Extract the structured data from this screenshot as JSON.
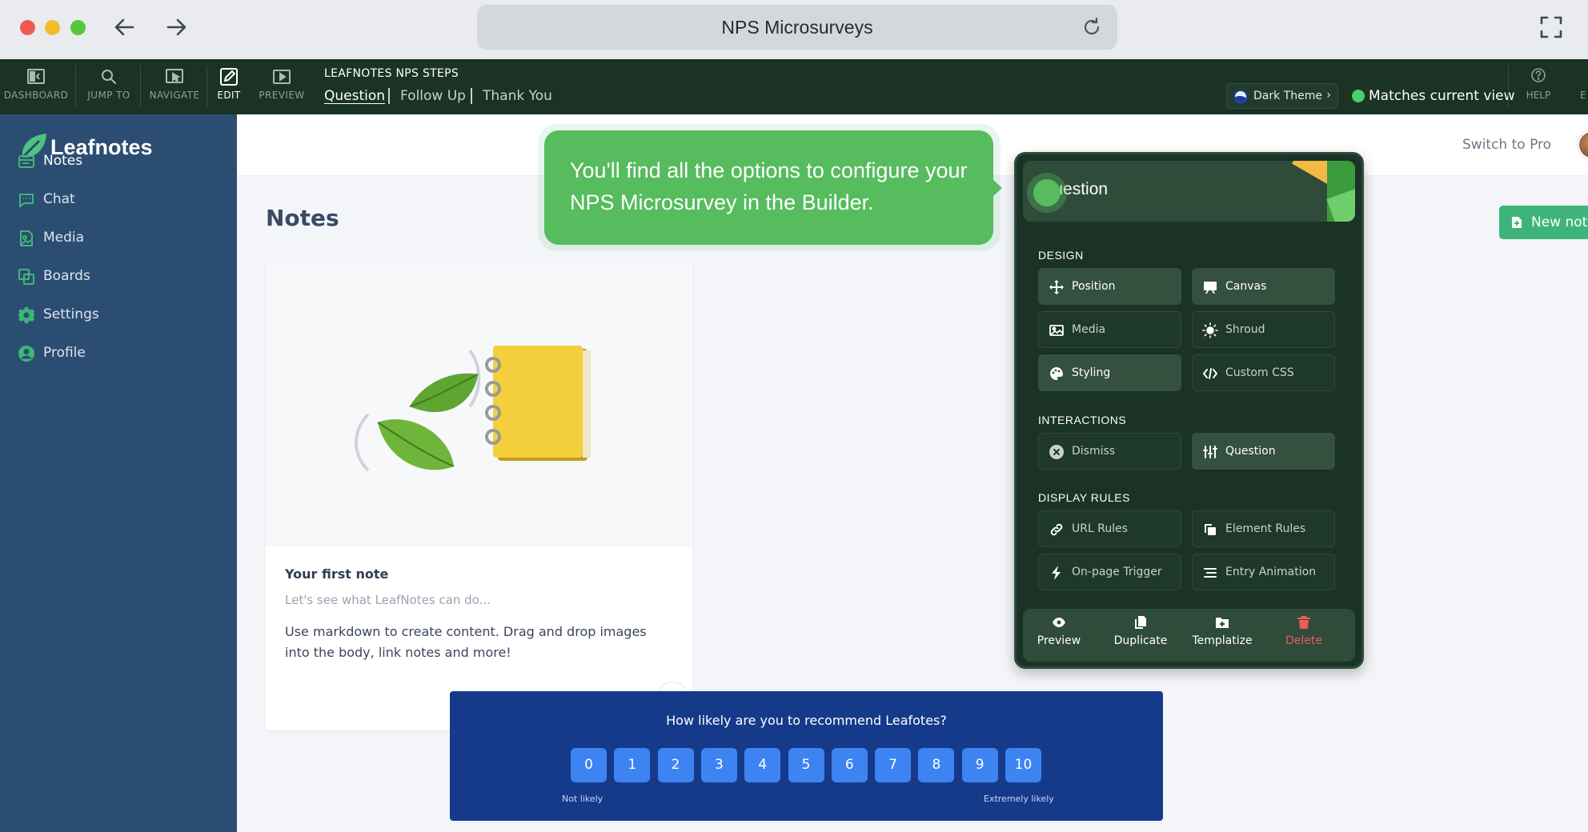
{
  "window": {
    "title": "NPS Microsurveys"
  },
  "toolbar": {
    "tools": [
      {
        "label": "DASHBOARD",
        "icon": "dashboard-icon"
      },
      {
        "label": "JUMP TO",
        "icon": "search-icon"
      },
      {
        "label": "NAVIGATE",
        "icon": "cursor-icon"
      },
      {
        "label": "EDIT",
        "icon": "edit-icon",
        "active": true
      },
      {
        "label": "PREVIEW",
        "icon": "play-icon"
      }
    ],
    "steps_heading": "LEAFNOTES NPS STEPS",
    "steps": [
      {
        "label": "Question",
        "active": true
      },
      {
        "label": "Follow Up"
      },
      {
        "label": "Thank You"
      }
    ],
    "theme_label": "Dark Theme",
    "match_label": "Matches current view",
    "help_label": "HELP",
    "help_cut": "E"
  },
  "app": {
    "brand": "Leafnotes",
    "nav": [
      {
        "label": "Notes",
        "icon": "notes-icon",
        "active": true
      },
      {
        "label": "Chat",
        "icon": "chat-icon"
      },
      {
        "label": "Media",
        "icon": "media-icon"
      },
      {
        "label": "Boards",
        "icon": "boards-icon"
      },
      {
        "label": "Settings",
        "icon": "gear-icon"
      },
      {
        "label": "Profile",
        "icon": "profile-icon"
      }
    ],
    "switch_pro": "Switch to Pro",
    "page_title": "Notes",
    "new_note": "New note"
  },
  "card": {
    "title": "Your first note",
    "subtitle": "Let's see what LeafNotes can do...",
    "body": "Use markdown to create content. Drag and drop images into the body, link notes and more!"
  },
  "tooltip": {
    "text": "You'll find all the options to configure your NPS Microsurvey in the Builder."
  },
  "builder": {
    "title": "Question",
    "sections": {
      "design": "DESIGN",
      "interactions": "INTERACTIONS",
      "display_rules": "DISPLAY RULES"
    },
    "design_buttons": [
      {
        "label": "Position",
        "icon": "move-icon"
      },
      {
        "label": "Canvas",
        "icon": "canvas-icon"
      },
      {
        "label": "Media",
        "icon": "image-icon"
      },
      {
        "label": "Shroud",
        "icon": "sun-icon"
      },
      {
        "label": "Styling",
        "icon": "palette-icon"
      },
      {
        "label": "Custom CSS",
        "icon": "code-icon"
      }
    ],
    "interaction_buttons": [
      {
        "label": "Dismiss",
        "icon": "close-circle-icon"
      },
      {
        "label": "Question",
        "icon": "sliders-icon"
      }
    ],
    "rule_buttons": [
      {
        "label": "URL Rules",
        "icon": "link-icon"
      },
      {
        "label": "Element Rules",
        "icon": "copy-icon"
      },
      {
        "label": "On-page Trigger",
        "icon": "bolt-icon"
      },
      {
        "label": "Entry Animation",
        "icon": "align-icon"
      }
    ],
    "footer": [
      {
        "label": "Preview",
        "icon": "eye-icon"
      },
      {
        "label": "Duplicate",
        "icon": "duplicate-icon"
      },
      {
        "label": "Templatize",
        "icon": "folder-plus-icon"
      },
      {
        "label": "Delete",
        "icon": "trash-icon"
      }
    ]
  },
  "nps": {
    "question": "How likely are you to recommend Leafotes?",
    "scores": [
      "0",
      "1",
      "2",
      "3",
      "4",
      "5",
      "6",
      "7",
      "8",
      "9",
      "10"
    ],
    "low_label": "Not likely",
    "high_label": "Extremely likely"
  }
}
